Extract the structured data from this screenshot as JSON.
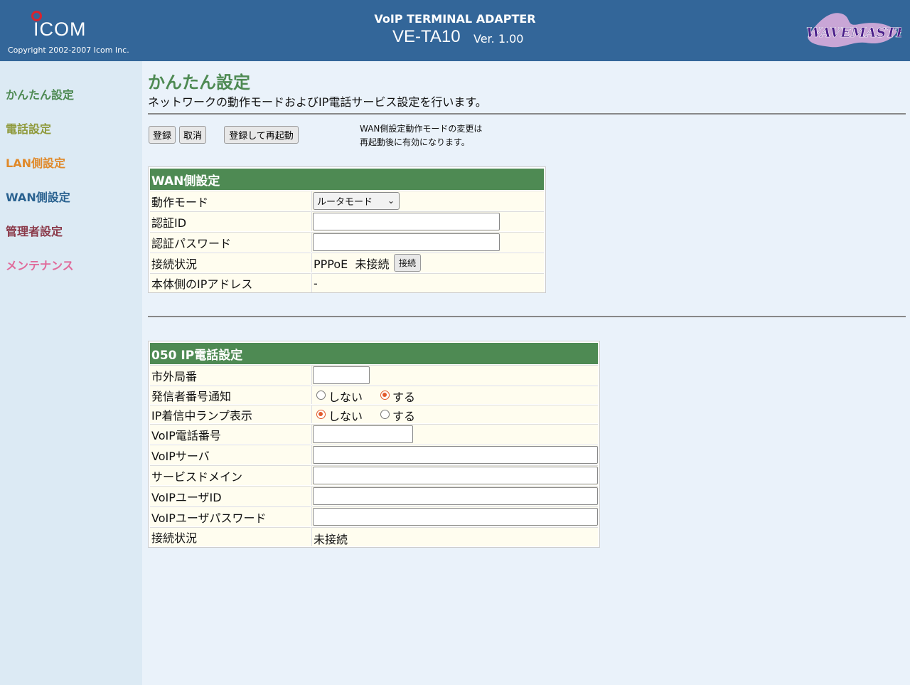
{
  "header": {
    "logo": "ICOM",
    "copyright": "Copyright 2002-2007 Icom Inc.",
    "subtitle": "VoIP TERMINAL ADAPTER",
    "model": "VE-TA10",
    "version": "Ver. 1.00",
    "wm_logo": "WAVEMASTER"
  },
  "sidebar": {
    "items": [
      {
        "label": "かんたん設定",
        "color": "#4e8a53"
      },
      {
        "label": "電話設定",
        "color": "#8f9a3c"
      },
      {
        "label": "LAN側設定",
        "color": "#e08a2b"
      },
      {
        "label": "WAN側設定",
        "color": "#2a6290"
      },
      {
        "label": "管理者設定",
        "color": "#8b3a4a"
      },
      {
        "label": "メンテナンス",
        "color": "#e06a9a"
      }
    ]
  },
  "main": {
    "title": "かんたん設定",
    "description": "ネットワークの動作モードおよびIP電話サービス設定を行います。",
    "buttons": {
      "register": "登録",
      "cancel": "取消",
      "register_restart": "登録して再起動"
    },
    "note_line1": "WAN側設定動作モードの変更は",
    "note_line2": "再起動後に有効になります。"
  },
  "wan": {
    "title": "WAN側設定",
    "mode_label": "動作モード",
    "mode_value": "ルータモード",
    "auth_id_label": "認証ID",
    "auth_id_value": "",
    "auth_pw_label": "認証パスワード",
    "auth_pw_value": "",
    "status_label": "接続状況",
    "status_value": "PPPoE  未接続",
    "connect_button": "接続",
    "ip_label": "本体側のIPアドレス",
    "ip_value": "-"
  },
  "ipphone": {
    "title": "050 IP電話設定",
    "area_code_label": "市外局番",
    "caller_id_label": "発信者番号通知",
    "caller_id_no": "しない",
    "caller_id_yes": "する",
    "caller_id_selected": "する",
    "lamp_label": "IP着信中ランプ表示",
    "lamp_no": "しない",
    "lamp_yes": "する",
    "lamp_selected": "しない",
    "voip_number_label": "VoIP電話番号",
    "voip_server_label": "VoIPサーバ",
    "service_domain_label": "サービスドメイン",
    "voip_user_id_label": "VoIPユーザID",
    "voip_user_pw_label": "VoIPユーザパスワード",
    "status_label": "接続状況",
    "status_value": "未接続"
  }
}
